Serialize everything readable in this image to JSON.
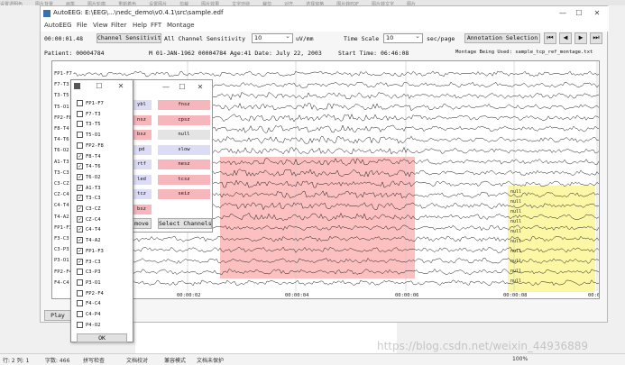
{
  "topstrip": [
    "设置透明色",
    "图片背景",
    "画笔",
    "图片轮廓",
    "重新着色",
    "设置图片",
    "剪裁",
    "图片效果",
    "文字环绕",
    "裁剪",
    "对齐",
    "选择窗格",
    "图片转PDF",
    "图片转文字",
    "图片"
  ],
  "window": {
    "title": "AutoEEG:  E:\\EEG\\...\\nedc_demo\\v0.4.1\\src\\sample.edf",
    "minimize": "—",
    "maximize": "☐",
    "close": "✕"
  },
  "menu": [
    "AutoEEG",
    "File",
    "View",
    "Filter",
    "Help",
    "FFT",
    "Montage"
  ],
  "toolbar": {
    "time": "00:00:01.48",
    "channel_sensitivity_btn": "Channel Sensitivity",
    "all_channel_label": "All Channel Sensitivity",
    "sensitivity_value": "10",
    "sensitivity_unit": "uV/mm",
    "time_scale_label": "Time Scale",
    "time_scale_value": "10",
    "time_scale_unit": "sec/page",
    "annotation_btn": "Annotation Selection",
    "first_icon": "⏮",
    "prev_icon": "◀",
    "next_icon": "▶",
    "last_icon": "⏭",
    "patient": "Patient: 00004784",
    "patient_info": "M 01-JAN-1962 00004784 Age:41 Date: July 22, 2003",
    "start_time": "Start Time: 06:46:08",
    "montage": "Montage Being Used: sample_tcp_ref_montage.txt"
  },
  "plot": {
    "channels": [
      "FP1-F7",
      "F7-T3",
      "T3-T5",
      "T5-O1",
      "FP2-F8",
      "F8-T4",
      "T4-T6",
      "T6-O2",
      "A1-T3",
      "T3-C3",
      "C3-CZ",
      "CZ-C4",
      "C4-T4",
      "T4-A2",
      "FP1-F3",
      "F3-C3",
      "C3-P3",
      "P3-O1",
      "FP2-F4",
      "F4-C4"
    ],
    "time_labels": [
      "00:00:02",
      "00:00:04",
      "00:00:06",
      "00:00:08",
      "00:0"
    ],
    "yellow_labels": [
      "null",
      "null",
      "null",
      "null",
      "null",
      "null",
      "null",
      "null",
      "null",
      "null"
    ]
  },
  "play_button": "Play",
  "channel_dialog": {
    "title_icon": "▣",
    "items": [
      {
        "label": "FP1-F7",
        "checked": false
      },
      {
        "label": "F7-T3",
        "checked": false
      },
      {
        "label": "T3-T5",
        "checked": false
      },
      {
        "label": "T5-O1",
        "checked": false
      },
      {
        "label": "FP2-F8",
        "checked": false
      },
      {
        "label": "F8-T4",
        "checked": true
      },
      {
        "label": "T4-T6",
        "checked": true
      },
      {
        "label": "T6-O2",
        "checked": true
      },
      {
        "label": "A1-T3",
        "checked": true
      },
      {
        "label": "T3-C3",
        "checked": true
      },
      {
        "label": "C3-CZ",
        "checked": true
      },
      {
        "label": "CZ-C4",
        "checked": true
      },
      {
        "label": "C4-T4",
        "checked": true
      },
      {
        "label": "T4-A2",
        "checked": true
      },
      {
        "label": "FP1-F3",
        "checked": true
      },
      {
        "label": "F3-C3",
        "checked": true
      },
      {
        "label": "C3-P3",
        "checked": false
      },
      {
        "label": "P3-O1",
        "checked": false
      },
      {
        "label": "FP2-F4",
        "checked": false
      },
      {
        "label": "F4-C4",
        "checked": false
      },
      {
        "label": "C4-P4",
        "checked": false
      },
      {
        "label": "P4-O2",
        "checked": false
      }
    ],
    "ok": "OK",
    "check_mark": "✓"
  },
  "annotation_dialog": {
    "tags": [
      {
        "left": "ybl",
        "right": "fnsz"
      },
      {
        "left": "nsz",
        "right": "cpsz"
      },
      {
        "left": "bsz",
        "right": "null"
      },
      {
        "left": "pd",
        "right": "slow"
      },
      {
        "left": "rtf",
        "right": "nesz"
      },
      {
        "left": "led",
        "right": "tcsz"
      },
      {
        "left": "tcz",
        "right": "seiz"
      },
      {
        "left": "bsz",
        "right": ""
      }
    ],
    "remove": "move",
    "select_channels": "Select Channels",
    "colors": {
      "pink": "#f7b6bb",
      "lavender": "#dcdcf6",
      "gray": "#e4e4e4"
    }
  },
  "statusbar": {
    "page": "行: 2  列: 1",
    "words": "字数: 466",
    "spell": "拼写检查",
    "proof": "文档校对",
    "compat": "兼容模式",
    "unprotected": "文档未保护",
    "zoom": "100%"
  },
  "watermark": "https://blog.csdn.net/weixin_44936889"
}
